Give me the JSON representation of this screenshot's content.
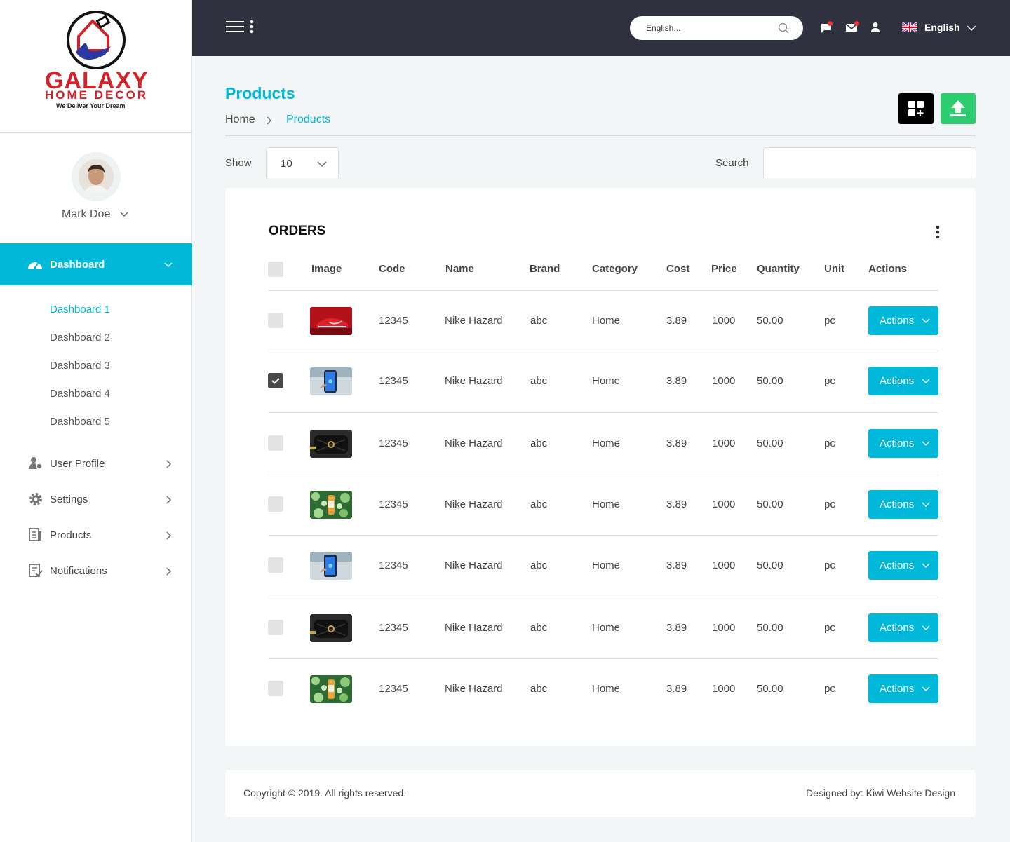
{
  "brand": {
    "name_line1": "GALAXY",
    "name_line2": "HOME DECOR",
    "tagline": "We Deliver Your Dream"
  },
  "user": {
    "name": "Mark Doe"
  },
  "sidebar": {
    "active": {
      "label": "Dashboard",
      "icon": "dashboard-gauge-icon"
    },
    "sub_items": [
      "Dashboard 1",
      "Dashboard 2",
      "Dashboard 3",
      "Dashboard 4",
      "Dashboard 5"
    ],
    "items": [
      {
        "label": "User Profile",
        "icon": "user-profile-icon"
      },
      {
        "label": "Settings",
        "icon": "gear-icon"
      },
      {
        "label": "Products",
        "icon": "products-icon"
      },
      {
        "label": "Notifications",
        "icon": "notifications-icon"
      }
    ]
  },
  "topbar": {
    "search_placeholder": "English...",
    "language": "English"
  },
  "page": {
    "title": "Products",
    "breadcrumb": [
      "Home",
      "Products"
    ]
  },
  "controls": {
    "show_label": "Show",
    "show_value": "10",
    "search_label": "Search"
  },
  "table": {
    "title": "ORDERS",
    "columns": [
      "Image",
      "Code",
      "Name",
      "Brand",
      "Category",
      "Cost",
      "Price",
      "Quantity",
      "Unit",
      "Actions"
    ],
    "rows": [
      {
        "image": "red-sneaker",
        "checked": false,
        "code": "12345",
        "name": "Nike Hazard",
        "brand": "abc",
        "category": "Home",
        "cost": "3.89",
        "price": "1000",
        "quantity": "50.00",
        "unit": "pc",
        "action": "Actions"
      },
      {
        "image": "smartphone",
        "checked": true,
        "code": "12345",
        "name": "Nike Hazard",
        "brand": "abc",
        "category": "Home",
        "cost": "3.89",
        "price": "1000",
        "quantity": "50.00",
        "unit": "pc",
        "action": "Actions"
      },
      {
        "image": "black-bag",
        "checked": false,
        "code": "12345",
        "name": "Nike Hazard",
        "brand": "abc",
        "category": "Home",
        "cost": "3.89",
        "price": "1000",
        "quantity": "50.00",
        "unit": "pc",
        "action": "Actions"
      },
      {
        "image": "bottle-on-leaves",
        "checked": false,
        "code": "12345",
        "name": "Nike Hazard",
        "brand": "abc",
        "category": "Home",
        "cost": "3.89",
        "price": "1000",
        "quantity": "50.00",
        "unit": "pc",
        "action": "Actions"
      },
      {
        "image": "smartphone",
        "checked": false,
        "code": "12345",
        "name": "Nike Hazard",
        "brand": "abc",
        "category": "Home",
        "cost": "3.89",
        "price": "1000",
        "quantity": "50.00",
        "unit": "pc",
        "action": "Actions"
      },
      {
        "image": "black-bag",
        "checked": false,
        "code": "12345",
        "name": "Nike Hazard",
        "brand": "abc",
        "category": "Home",
        "cost": "3.89",
        "price": "1000",
        "quantity": "50.00",
        "unit": "pc",
        "action": "Actions"
      },
      {
        "image": "bottle-on-leaves",
        "checked": false,
        "code": "12345",
        "name": "Nike Hazard",
        "brand": "abc",
        "category": "Home",
        "cost": "3.89",
        "price": "1000",
        "quantity": "50.00",
        "unit": "pc",
        "action": "Actions"
      }
    ]
  },
  "footer": {
    "copyright": "Copyright © 2019. All rights reserved.",
    "designed_by": "Designed by: Kiwi Website Design"
  },
  "colors": {
    "accent": "#00b8da",
    "topbar": "#2f323e",
    "success": "#2ecc71",
    "notification_dot": "#e53935"
  }
}
